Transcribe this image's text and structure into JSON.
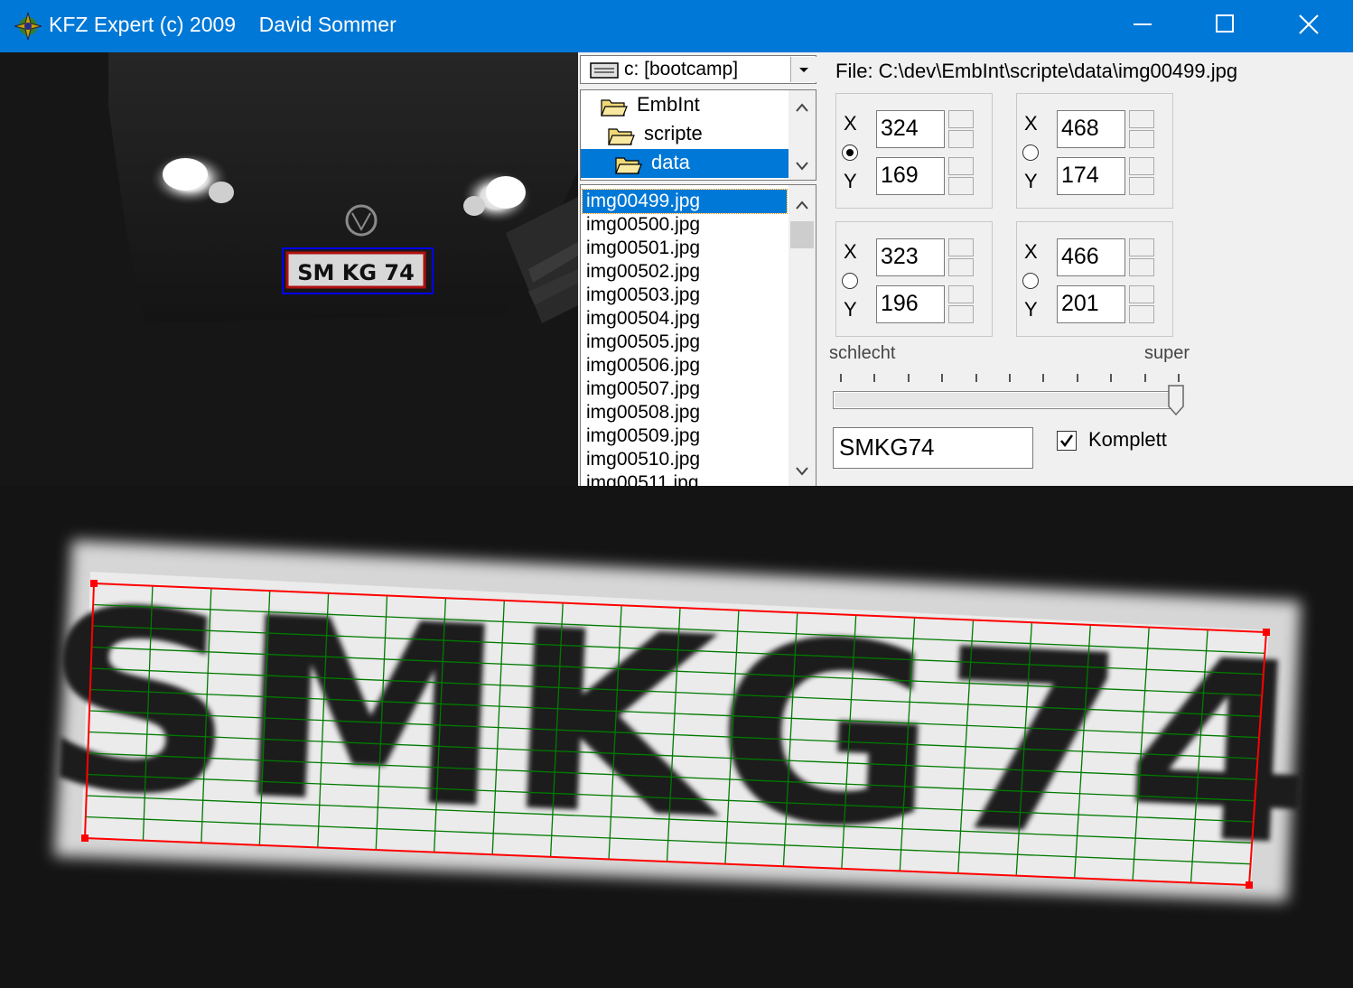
{
  "window": {
    "title": "KFZ Expert (c) 2009    David Sommer",
    "icon": "app-logo-icon"
  },
  "drive": {
    "label": "c: [bootcamp]",
    "icon": "drive-icon"
  },
  "folders": [
    {
      "label": "EmbInt",
      "icon": "folder-open-icon"
    },
    {
      "label": "scripte",
      "icon": "folder-open-icon"
    },
    {
      "label": "data",
      "icon": "folder-open-icon",
      "selected": true
    }
  ],
  "files": [
    "img00499.jpg",
    "img00500.jpg",
    "img00501.jpg",
    "img00502.jpg",
    "img00503.jpg",
    "img00504.jpg",
    "img00505.jpg",
    "img00506.jpg",
    "img00507.jpg",
    "img00508.jpg",
    "img00509.jpg",
    "img00510.jpg",
    "img00511.jpg"
  ],
  "selected_file_index": 0,
  "file_path": "File: C:\\dev\\EmbInt\\scripte\\data\\img00499.jpg",
  "points": [
    {
      "x": "324",
      "y": "169",
      "selected": true
    },
    {
      "x": "468",
      "y": "174",
      "selected": false
    },
    {
      "x": "323",
      "y": "196",
      "selected": false
    },
    {
      "x": "466",
      "y": "201",
      "selected": false
    }
  ],
  "labels": {
    "x": "X",
    "y": "Y"
  },
  "quality": {
    "low_label": "schlecht",
    "high_label": "super",
    "value": 0.98
  },
  "result": {
    "plate_text": "SMKG74",
    "complete_label": "Komplett",
    "complete_checked": true
  },
  "plate": {
    "text": "SMKG74",
    "small_text": "SM KG 74"
  },
  "colors": {
    "titlebar": "#0078d7",
    "selection": "#0078d7",
    "plate_outline": "#ff0000",
    "grid": "#007a00",
    "roi_box": "#0000ff"
  }
}
